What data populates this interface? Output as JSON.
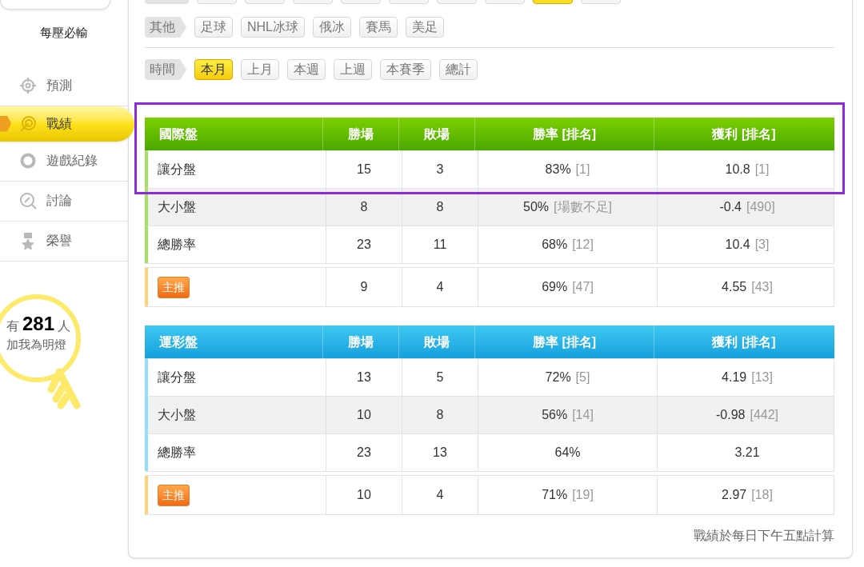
{
  "user": {
    "name": "每壓必輸"
  },
  "sidebar": {
    "items": [
      {
        "label": "預測",
        "selected": false
      },
      {
        "label": "戰績",
        "selected": true
      },
      {
        "label": "遊戲紀錄",
        "selected": false
      },
      {
        "label": "討論",
        "selected": false
      },
      {
        "label": "榮譽",
        "selected": false
      }
    ]
  },
  "fans": {
    "prefix": "有",
    "count": "281",
    "suffix": "人",
    "caption": "加我為明燈"
  },
  "cut_filter_row": [
    {
      "selected": false
    },
    {
      "selected": false
    },
    {
      "selected": false
    },
    {
      "selected": false
    },
    {
      "selected": false
    },
    {
      "selected": false
    },
    {
      "selected": false
    },
    {
      "selected": true
    },
    {
      "selected": false
    }
  ],
  "filters": [
    {
      "label": "其他",
      "options": [
        {
          "label": "足球",
          "selected": false
        },
        {
          "label": "NHL冰球",
          "selected": false
        },
        {
          "label": "俄冰",
          "selected": false
        },
        {
          "label": "賽馬",
          "selected": false
        },
        {
          "label": "美足",
          "selected": false
        }
      ]
    },
    {
      "label": "時間",
      "options": [
        {
          "label": "本月",
          "selected": true
        },
        {
          "label": "上月",
          "selected": false
        },
        {
          "label": "本週",
          "selected": false
        },
        {
          "label": "上週",
          "selected": false
        },
        {
          "label": "本賽季",
          "selected": false
        },
        {
          "label": "總計",
          "selected": false
        }
      ]
    }
  ],
  "tables": [
    {
      "framed": true,
      "columns": [
        "國際盤",
        "勝場",
        "敗場",
        "勝率 [排名]",
        "獲利 [排名]"
      ],
      "rows": [
        {
          "kind": "plain",
          "label": "讓分盤",
          "wins": "15",
          "losses": "3",
          "rate": "83%",
          "rate_rank": "[1]",
          "profit": "10.8",
          "profit_rank": "[1]"
        },
        {
          "kind": "plain",
          "label": "大小盤",
          "wins": "8",
          "losses": "8",
          "rate": "50%",
          "rate_rank": "[場數不足]",
          "profit": "-0.4",
          "profit_rank": "[490]"
        },
        {
          "kind": "plain",
          "label": "總勝率",
          "wins": "23",
          "losses": "11",
          "rate": "68%",
          "rate_rank": "[12]",
          "profit": "10.4",
          "profit_rank": "[3]"
        },
        {
          "kind": "badge",
          "label": "主推",
          "wins": "9",
          "losses": "4",
          "rate": "69%",
          "rate_rank": "[47]",
          "profit": "4.55",
          "profit_rank": "[43]"
        }
      ]
    },
    {
      "framed": false,
      "columns": [
        "運彩盤",
        "勝場",
        "敗場",
        "勝率 [排名]",
        "獲利 [排名]"
      ],
      "rows": [
        {
          "kind": "plain",
          "label": "讓分盤",
          "wins": "13",
          "losses": "5",
          "rate": "72%",
          "rate_rank": "[5]",
          "profit": "4.19",
          "profit_rank": "[13]"
        },
        {
          "kind": "plain",
          "label": "大小盤",
          "wins": "10",
          "losses": "8",
          "rate": "56%",
          "rate_rank": "[14]",
          "profit": "-0.98",
          "profit_rank": "[442]"
        },
        {
          "kind": "plain",
          "label": "總勝率",
          "wins": "23",
          "losses": "13",
          "rate": "64%",
          "profit": "3.21"
        },
        {
          "kind": "badge",
          "label": "主推",
          "wins": "10",
          "losses": "4",
          "rate": "71%",
          "rate_rank": "[19]",
          "profit": "2.97",
          "profit_rank": "[18]"
        }
      ]
    }
  ],
  "footnote": "戰績於每日下午五點計算"
}
